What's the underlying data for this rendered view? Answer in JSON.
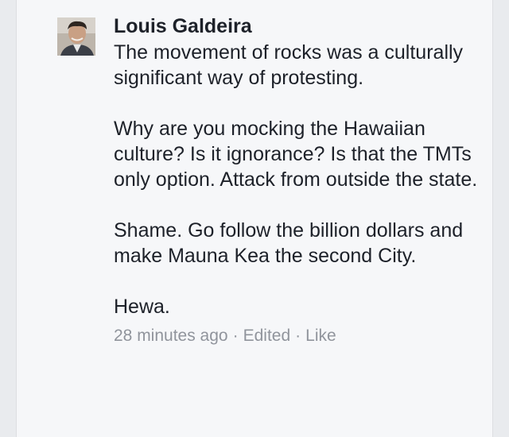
{
  "comment": {
    "author": "Louis Galdeira",
    "avatar_icon": "profile-photo",
    "paragraphs": [
      "The movement of rocks was a culturally significant way of protesting.",
      "Why are you mocking the Hawaiian culture? Is it ignorance? Is that the TMTs only option. Attack from outside the state.",
      "Shame. Go follow the billion dollars and make Mauna Kea the second City.",
      "Hewa."
    ],
    "timestamp": "28 minutes ago",
    "separator": "·",
    "edited_label": "Edited",
    "like_label": "Like"
  },
  "colors": {
    "text": "#1d2129",
    "meta": "#90949c",
    "background": "#f6f7f9"
  }
}
